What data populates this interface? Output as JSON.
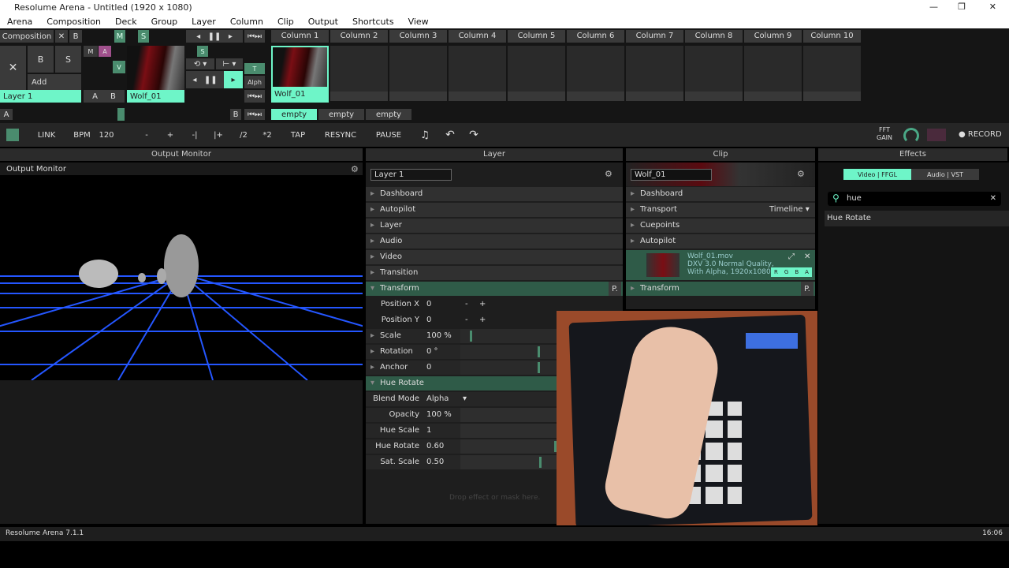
{
  "window": {
    "title": "Resolume Arena - Untitled (1920 x 1080)",
    "controls": [
      "—",
      "❐",
      "✕"
    ]
  },
  "menu": [
    "Arena",
    "Composition",
    "Deck",
    "Group",
    "Layer",
    "Column",
    "Clip",
    "Output",
    "Shortcuts",
    "View"
  ],
  "composition": {
    "label": "Composition",
    "x": "✕",
    "b": "B",
    "m": "M",
    "s": "S"
  },
  "columns": [
    "Column 1",
    "Column 2",
    "Column 3",
    "Column 4",
    "Column 5",
    "Column 6",
    "Column 7",
    "Column 8",
    "Column 9",
    "Column 10"
  ],
  "layer": {
    "x": "✕",
    "b": "B",
    "s": "S",
    "add": "Add",
    "m": "M",
    "a": "A",
    "v": "V",
    "name": "Layer 1",
    "ab_a": "A",
    "ab_b": "B",
    "clip": "Wolf_01",
    "t": "T",
    "alph": "Alph",
    "s2": "S"
  },
  "clips": [
    {
      "name": "Wolf_01"
    }
  ],
  "deck": {
    "a": "A",
    "b": "B",
    "decks": [
      "empty",
      "empty",
      "empty"
    ]
  },
  "toolbar": {
    "link": "LINK",
    "bpm_label": "BPM",
    "bpm": "120",
    "minus": "-",
    "plus": "+",
    "nudge_l": "-|",
    "nudge_r": "|+",
    "half": "/2",
    "double": "*2",
    "tap": "TAP",
    "resync": "RESYNC",
    "pause": "PAUSE",
    "fft": "FFT",
    "gain": "GAIN",
    "record": "RECORD"
  },
  "output": {
    "header": "Output Monitor",
    "title": "Output Monitor"
  },
  "layerPanel": {
    "header": "Layer",
    "name": "Layer 1",
    "sections": [
      "Dashboard",
      "Autopilot",
      "Layer",
      "Audio",
      "Video",
      "Transition"
    ],
    "transform": "Transform",
    "p": "P.",
    "params": [
      {
        "label": "Position X",
        "value": "0"
      },
      {
        "label": "Position Y",
        "value": "0"
      },
      {
        "label": "Scale",
        "value": "100 %"
      },
      {
        "label": "Rotation",
        "value": "0 °"
      },
      {
        "label": "Anchor",
        "value": "0"
      }
    ],
    "effect": "Hue Rotate",
    "effectParams": [
      {
        "label": "Blend Mode",
        "value": "Alpha"
      },
      {
        "label": "Opacity",
        "value": "100 %"
      },
      {
        "label": "Hue Scale",
        "value": "1"
      },
      {
        "label": "Hue Rotate",
        "value": "0.60"
      },
      {
        "label": "Sat. Scale",
        "value": "0.50"
      }
    ],
    "drop": "Drop effect or mask here."
  },
  "clipPanel": {
    "header": "Clip",
    "name": "Wolf_01",
    "sections": [
      "Dashboard",
      "Transport",
      "Cuepoints",
      "Autopilot"
    ],
    "timeline": "Timeline",
    "file": "Wolf_01.mov",
    "codec": "DXV 3.0 Normal Quality,",
    "info": "With Alpha, 1920x1080,",
    "rgba": [
      "R",
      "G",
      "B",
      "A"
    ],
    "transform": "Transform",
    "p": "P."
  },
  "effects": {
    "header": "Effects",
    "tabs": [
      "Video | FFGL",
      "Audio | VST"
    ],
    "search": "hue",
    "result": "Hue Rotate"
  },
  "status": {
    "version": "Resolume Arena 7.1.1",
    "time": "16:06"
  },
  "colors": {
    "accent": "#6ef5c8",
    "active": "#2f5b48"
  }
}
